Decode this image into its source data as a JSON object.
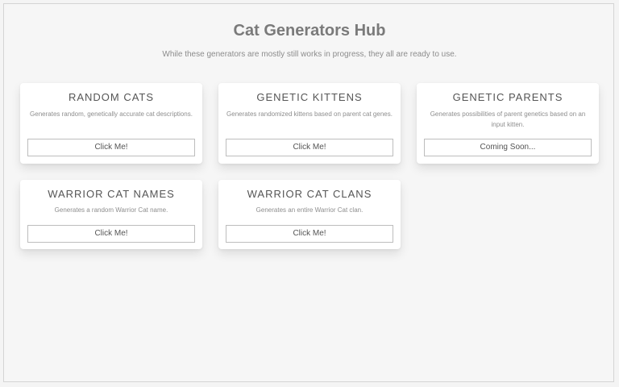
{
  "header": {
    "title": "Cat Generators Hub",
    "subtitle": "While these generators are mostly still works in progress, they all are ready to use."
  },
  "cards": [
    {
      "title": "RANDOM CATS",
      "description": "Generates random, genetically accurate cat descriptions.",
      "button_label": "Click Me!"
    },
    {
      "title": "GENETIC KITTENS",
      "description": "Generates randomized kittens based on parent cat genes.",
      "button_label": "Click Me!"
    },
    {
      "title": "GENETIC PARENTS",
      "description": "Generates possibilities of parent genetics based on an input kitten.",
      "button_label": "Coming Soon..."
    },
    {
      "title": "WARRIOR CAT NAMES",
      "description": "Generates a random Warrior Cat name.",
      "button_label": "Click Me!"
    },
    {
      "title": "WARRIOR CAT CLANS",
      "description": "Generates an entire Warrior Cat clan.",
      "button_label": "Click Me!"
    }
  ]
}
